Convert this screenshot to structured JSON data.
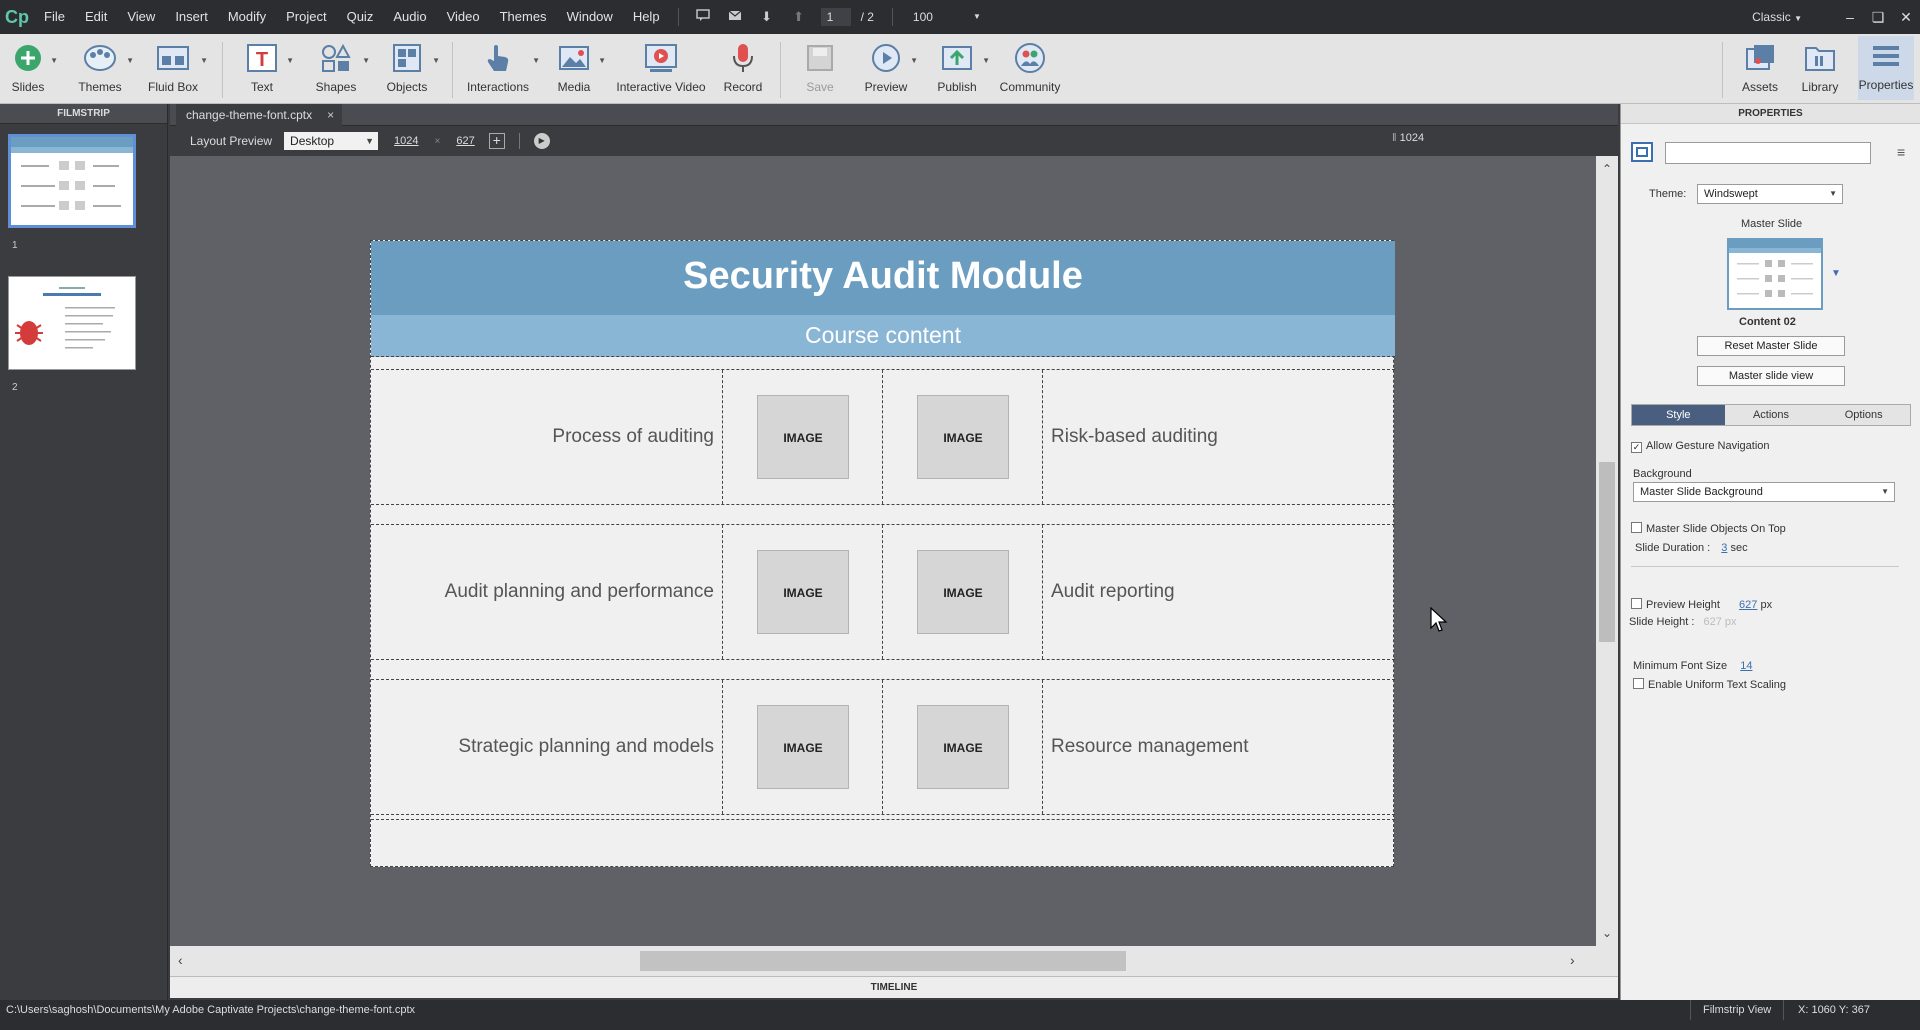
{
  "app": {
    "logo": "Cp"
  },
  "menu": [
    "File",
    "Edit",
    "View",
    "Insert",
    "Modify",
    "Project",
    "Quiz",
    "Audio",
    "Video",
    "Themes",
    "Window",
    "Help"
  ],
  "nav": {
    "current_page": "1",
    "total_pages": "/ 2",
    "zoom": "100"
  },
  "workspace": {
    "label": "Classic"
  },
  "toolbar": {
    "slides": "Slides",
    "themes": "Themes",
    "fluid_box": "Fluid Box",
    "text": "Text",
    "shapes": "Shapes",
    "objects": "Objects",
    "interactions": "Interactions",
    "media": "Media",
    "interactive_video": "Interactive Video",
    "record": "Record",
    "save": "Save",
    "preview": "Preview",
    "publish": "Publish",
    "community": "Community",
    "assets": "Assets",
    "library": "Library",
    "properties": "Properties"
  },
  "filmstrip": {
    "header": "FILMSTRIP",
    "slides": [
      {
        "number": "1"
      },
      {
        "number": "2"
      }
    ]
  },
  "document": {
    "tab": "change-theme-font.cptx",
    "close": "×"
  },
  "layout_preview": {
    "label": "Layout Preview",
    "device": "Desktop",
    "width": "1024",
    "height": "627",
    "ruler": "1024"
  },
  "slide": {
    "title": "Security Audit Module",
    "subtitle": "Course content",
    "rows": [
      {
        "left": "Process of auditing",
        "right": "Risk-based auditing",
        "img1": "IMAGE",
        "img2": "IMAGE"
      },
      {
        "left": "Audit planning and performance",
        "right": "Audit reporting",
        "img1": "IMAGE",
        "img2": "IMAGE"
      },
      {
        "left": "Strategic planning and models",
        "right": "Resource management",
        "img1": "IMAGE",
        "img2": "IMAGE"
      }
    ]
  },
  "timeline": {
    "label": "TIMELINE"
  },
  "properties": {
    "header": "PROPERTIES",
    "theme_label": "Theme:",
    "theme_value": "Windswept",
    "master_slide_label": "Master Slide",
    "master_slide_name": "Content 02",
    "reset_master": "Reset Master Slide",
    "master_view": "Master slide view",
    "tabs": [
      "Style",
      "Actions",
      "Options"
    ],
    "allow_gesture": "Allow Gesture Navigation",
    "background_label": "Background",
    "background_value": "Master Slide Background",
    "master_on_top": "Master Slide Objects On Top",
    "duration_label": "Slide Duration :",
    "duration_value": "3",
    "duration_unit": "sec",
    "preview_height_label": "Preview Height",
    "preview_height_value": "627",
    "px": "px",
    "slide_height_label": "Slide Height :",
    "slide_height_value": "627 px",
    "min_font_label": "Minimum Font Size",
    "min_font_value": "14",
    "uniform_scaling": "Enable Uniform Text Scaling"
  },
  "status": {
    "path": "C:\\Users\\saghosh\\Documents\\My Adobe Captivate Projects\\change-theme-font.cptx",
    "view": "Filmstrip View",
    "coords": "X: 1060 Y: 367"
  },
  "colors": {
    "accent": "#6b9dc0",
    "subtitle_bar": "#8ab6d6",
    "tab_active": "#4a5f80",
    "logo": "#5fc7ad"
  }
}
